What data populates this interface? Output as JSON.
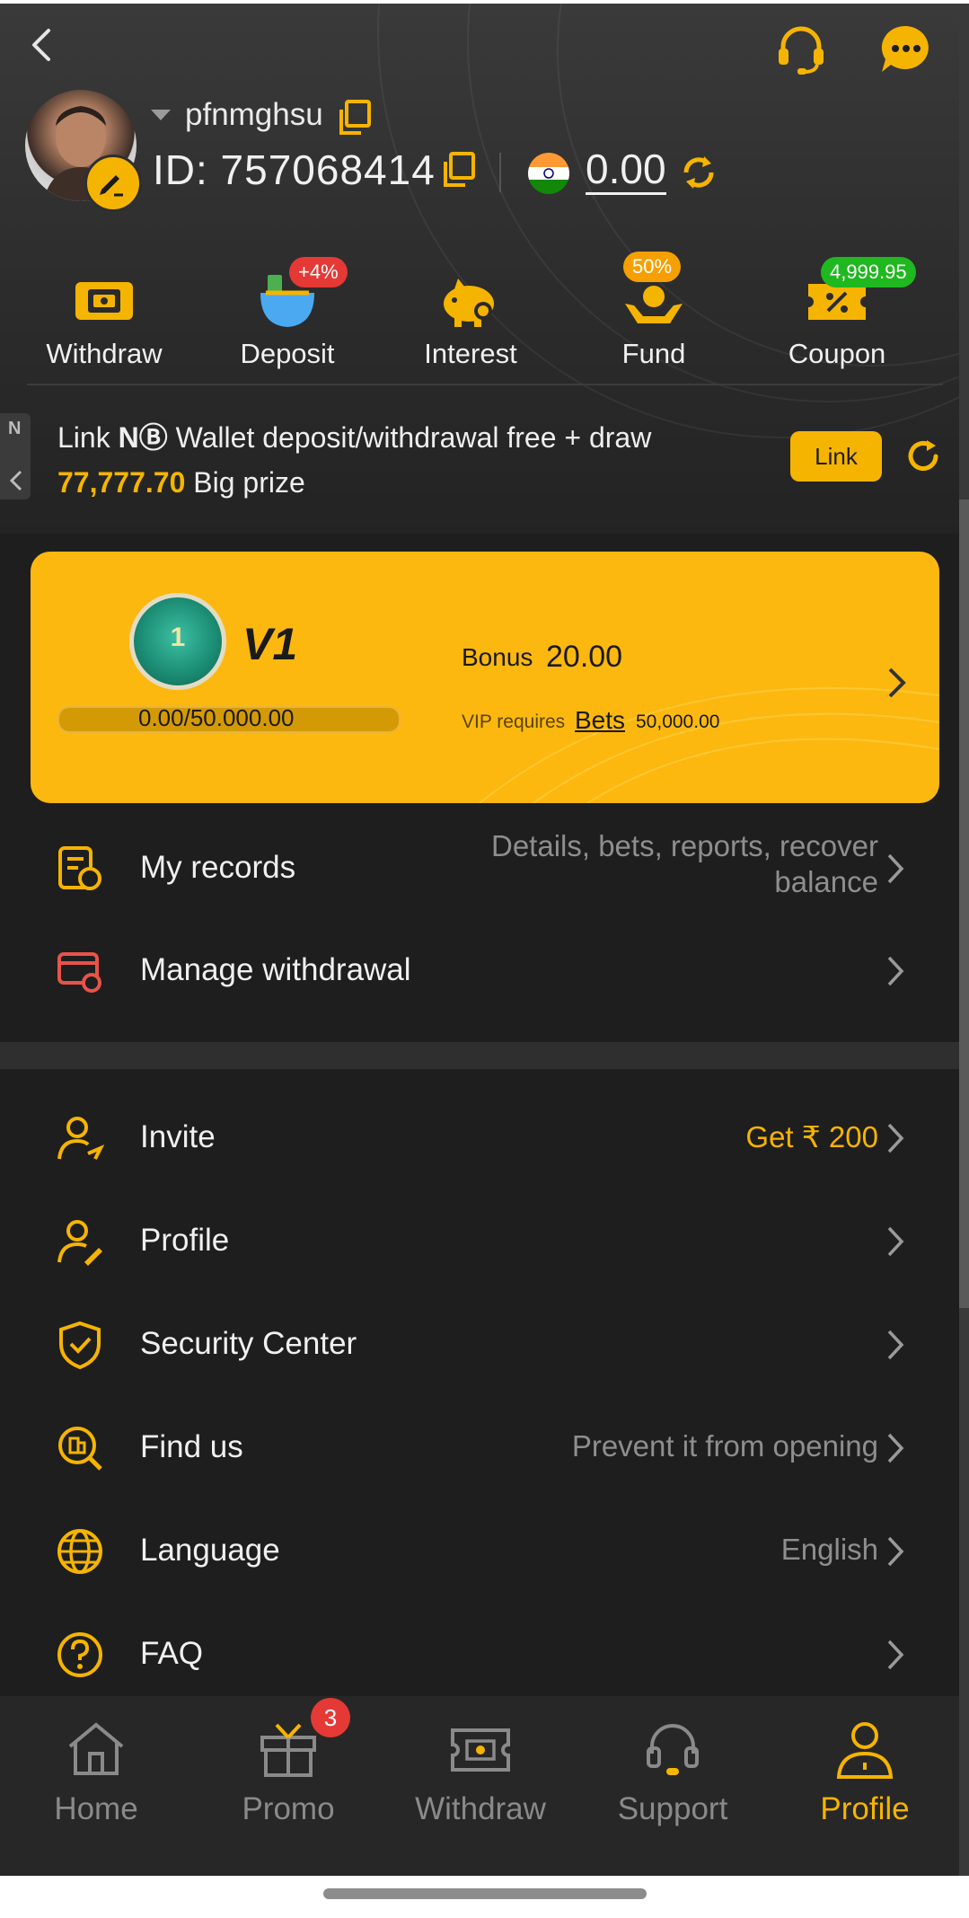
{
  "header": {
    "username": "pfnmghsu",
    "user_id": "ID: 757068414",
    "balance": "0.00"
  },
  "quick_actions": [
    {
      "label": "Withdraw"
    },
    {
      "label": "Deposit",
      "badge": "+4%"
    },
    {
      "label": "Interest"
    },
    {
      "label": "Fund",
      "badge": "50%"
    },
    {
      "label": "Coupon",
      "badge": "4,999.95"
    }
  ],
  "promo": {
    "text_before": "Link",
    "brand": "NⒷ",
    "text_mid": " Wallet deposit/withdrawal free + draw ",
    "amount": "77,777.70",
    "text_after": " Big prize",
    "button": "Link",
    "side_tab": "N"
  },
  "vip": {
    "level": "V1",
    "medal_number": "1",
    "progress": "0.00/50.000.00",
    "progress_fraction": 0,
    "bonus_label": "Bonus",
    "bonus_value": "20.00",
    "requires_label": "VIP requires",
    "bets_label": "Bets",
    "bets_value": "50,000.00"
  },
  "menu_group1": [
    {
      "label": "My records",
      "value": "Details, bets, reports, recover balance"
    },
    {
      "label": "Manage withdrawal",
      "value": ""
    }
  ],
  "menu_group2": [
    {
      "label": "Invite",
      "value": "Get ₹ 200"
    },
    {
      "label": "Profile",
      "value": ""
    },
    {
      "label": "Security Center",
      "value": ""
    },
    {
      "label": "Find us",
      "value": "Prevent it from opening"
    },
    {
      "label": "Language",
      "value": "English"
    },
    {
      "label": "FAQ",
      "value": ""
    }
  ],
  "bottom_nav": [
    {
      "label": "Home"
    },
    {
      "label": "Promo",
      "badge": "3"
    },
    {
      "label": "Withdraw"
    },
    {
      "label": "Support"
    },
    {
      "label": "Profile",
      "active": true
    }
  ],
  "colors": {
    "accent": "#f5b400",
    "background": "#1e1e1e",
    "badge_red": "#e53935",
    "badge_green": "#1fb81f"
  }
}
